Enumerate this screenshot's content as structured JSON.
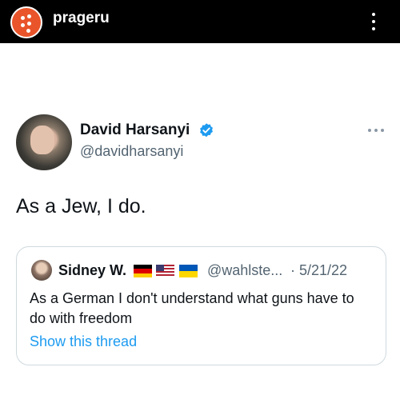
{
  "header": {
    "brand": "prageru",
    "colors": {
      "bar": "#000000",
      "logo": "#e9542a"
    }
  },
  "tweet": {
    "author_name": "David Harsanyi",
    "author_handle": "@davidharsanyi",
    "verified": true,
    "text": "As a Jew, I do.",
    "more_icon": "more-horizontal-icon"
  },
  "quote": {
    "name": "Sidney W.",
    "flags": [
      "germany-flag-icon",
      "usa-flag-icon",
      "ukraine-flag-icon"
    ],
    "handle": "@wahlste...",
    "separator": "·",
    "date": "5/21/22",
    "text": "As a German I don't understand what guns have to do with freedom",
    "show_thread": "Show this thread",
    "colors": {
      "link": "#1d9bf0",
      "secondary": "#536471",
      "border": "#cfd9de"
    }
  }
}
